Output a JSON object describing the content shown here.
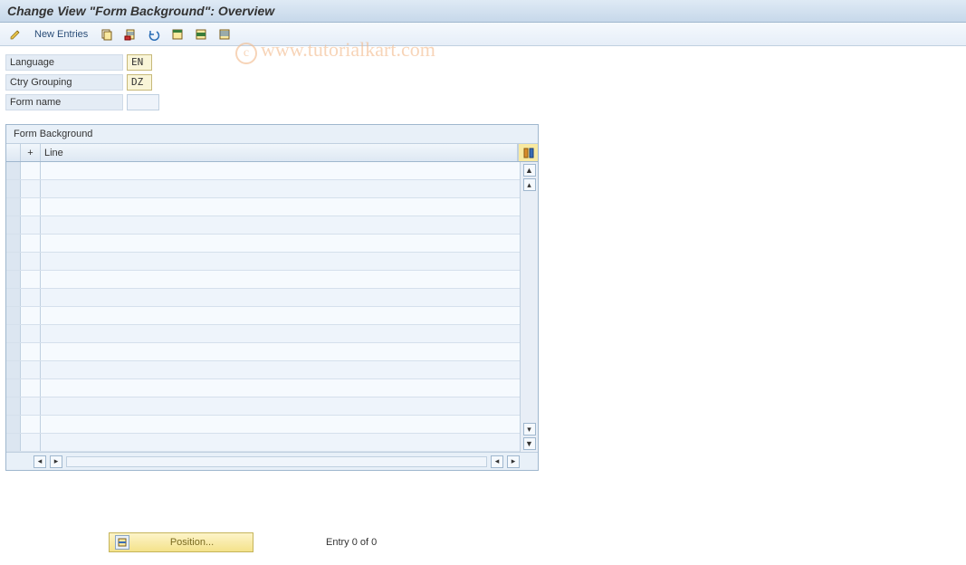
{
  "title": "Change View \"Form Background\": Overview",
  "toolbar": {
    "new_entries": "New Entries",
    "icons": {
      "edit": "edit-pencil-icon",
      "copy": "copy-icon",
      "delete": "delete-icon",
      "undo": "undo-icon",
      "select_all": "select-all-icon",
      "select_block": "select-block-icon",
      "deselect": "deselect-icon"
    }
  },
  "fields": {
    "language": {
      "label": "Language",
      "value": "EN"
    },
    "ctry_grouping": {
      "label": "Ctry Grouping",
      "value": "DZ"
    },
    "form_name": {
      "label": "Form name",
      "value": ""
    }
  },
  "grid": {
    "title": "Form Background",
    "cols": {
      "plus": "+",
      "line": "Line"
    },
    "row_count": 16
  },
  "footer": {
    "position_label": "Position...",
    "entry_text": "Entry 0 of 0"
  },
  "watermark": "www.tutorialkart.com"
}
